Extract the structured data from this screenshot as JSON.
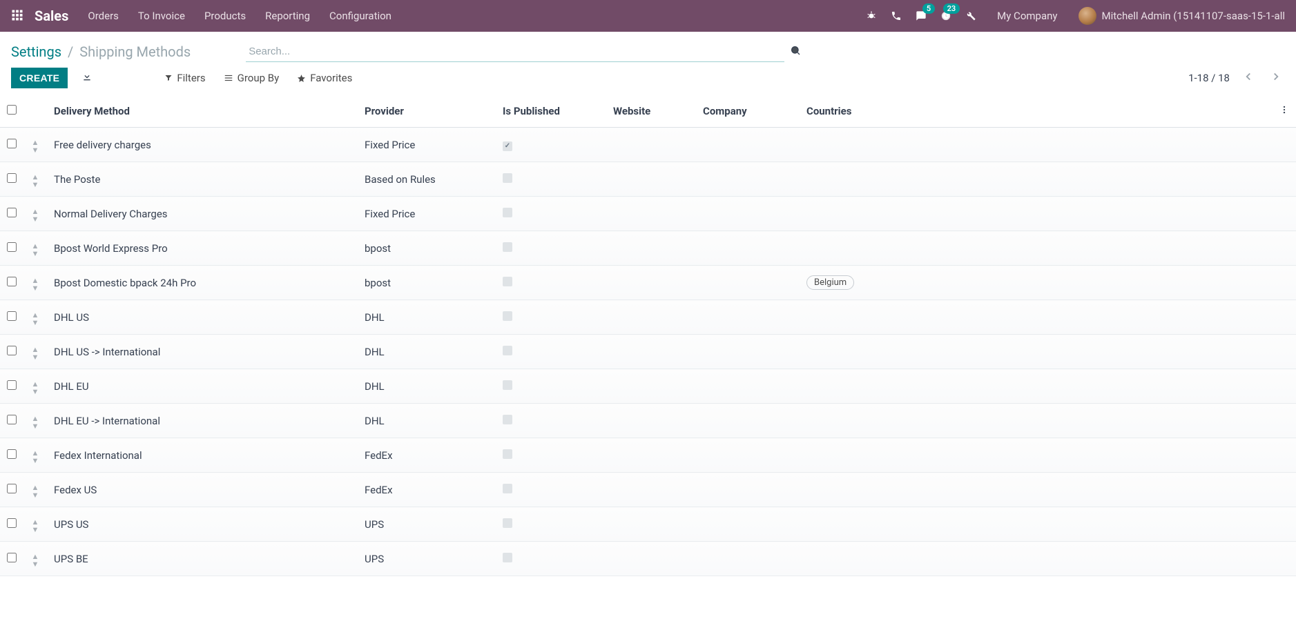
{
  "navbar": {
    "brand": "Sales",
    "menu": [
      "Orders",
      "To Invoice",
      "Products",
      "Reporting",
      "Configuration"
    ],
    "msg_badge": "5",
    "activity_badge": "23",
    "company": "My Company",
    "user_label": "Mitchell Admin (15141107-saas-15-1-all"
  },
  "breadcrumb": {
    "root": "Settings",
    "active": "Shipping Methods"
  },
  "search": {
    "placeholder": "Search..."
  },
  "toolbar": {
    "create": "CREATE",
    "filters": "Filters",
    "group_by": "Group By",
    "favorites": "Favorites",
    "pager": "1-18 / 18"
  },
  "table": {
    "headers": {
      "method": "Delivery Method",
      "provider": "Provider",
      "published": "Is Published",
      "website": "Website",
      "company": "Company",
      "countries": "Countries"
    },
    "rows": [
      {
        "method": "Free delivery charges",
        "provider": "Fixed Price",
        "published": true,
        "countries": []
      },
      {
        "method": "The Poste",
        "provider": "Based on Rules",
        "published": false,
        "countries": []
      },
      {
        "method": "Normal Delivery Charges",
        "provider": "Fixed Price",
        "published": false,
        "countries": []
      },
      {
        "method": "Bpost World Express Pro",
        "provider": "bpost",
        "published": false,
        "countries": []
      },
      {
        "method": "Bpost Domestic bpack 24h Pro",
        "provider": "bpost",
        "published": false,
        "countries": [
          "Belgium"
        ]
      },
      {
        "method": "DHL US",
        "provider": "DHL",
        "published": false,
        "countries": []
      },
      {
        "method": "DHL US -> International",
        "provider": "DHL",
        "published": false,
        "countries": []
      },
      {
        "method": "DHL EU",
        "provider": "DHL",
        "published": false,
        "countries": []
      },
      {
        "method": "DHL EU -> International",
        "provider": "DHL",
        "published": false,
        "countries": []
      },
      {
        "method": "Fedex International",
        "provider": "FedEx",
        "published": false,
        "countries": []
      },
      {
        "method": "Fedex US",
        "provider": "FedEx",
        "published": false,
        "countries": []
      },
      {
        "method": "UPS US",
        "provider": "UPS",
        "published": false,
        "countries": []
      },
      {
        "method": "UPS BE",
        "provider": "UPS",
        "published": false,
        "countries": []
      }
    ]
  }
}
